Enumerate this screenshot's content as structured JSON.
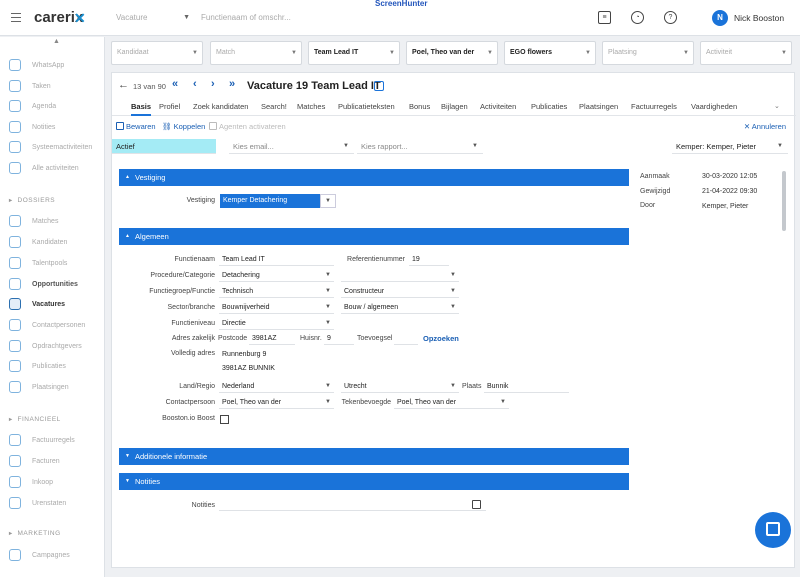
{
  "topbar": {
    "logo": "carerix",
    "selects": [
      {
        "label": "Vacature"
      },
      {
        "label": "Functienaam of omschr..."
      }
    ],
    "screenhunter": "ScreenHunter",
    "user_initial": "N",
    "user_name": "Nick Booston"
  },
  "sidebar": {
    "items": [
      {
        "label": "WhatsApp",
        "icon": "whatsapp-icon"
      },
      {
        "label": "Taken",
        "icon": "tasks-icon"
      },
      {
        "label": "Agenda",
        "icon": "calendar-icon"
      },
      {
        "label": "Notities",
        "icon": "notes-icon"
      },
      {
        "label": "Systeemactiviteiten",
        "icon": "system-activity-icon"
      },
      {
        "label": "Alle activiteiten",
        "icon": "activities-icon"
      }
    ],
    "dossiers_title": "DOSSIERS",
    "dossiers": [
      {
        "label": "Matches",
        "icon": "matches-icon"
      },
      {
        "label": "Kandidaten",
        "icon": "candidates-icon"
      },
      {
        "label": "Talentpools",
        "icon": "talentpool-icon"
      },
      {
        "label": "Opportunities",
        "icon": "opportunities-icon"
      },
      {
        "label": "Vacatures",
        "icon": "vacancies-icon"
      },
      {
        "label": "Contactpersonen",
        "icon": "contacts-icon"
      },
      {
        "label": "Opdrachtgevers",
        "icon": "clients-icon"
      },
      {
        "label": "Publicaties",
        "icon": "publications-icon"
      },
      {
        "label": "Plaatsingen",
        "icon": "placements-icon"
      }
    ],
    "financieel_title": "FINANCIEEL",
    "financieel": [
      {
        "label": "Factuurregels",
        "icon": "invoice-lines-icon"
      },
      {
        "label": "Facturen",
        "icon": "invoices-icon"
      },
      {
        "label": "Inkoop",
        "icon": "purchase-icon"
      },
      {
        "label": "Urenstaten",
        "icon": "timesheets-icon"
      }
    ],
    "marketing_title": "MARKETING",
    "marketing": [
      {
        "label": "Campagnes",
        "icon": "campaigns-icon"
      }
    ]
  },
  "filters": [
    {
      "label": "Kandidaat",
      "selected": false
    },
    {
      "label": "Match",
      "selected": false
    },
    {
      "label": "Team Lead IT",
      "selected": true
    },
    {
      "label": "Poel, Theo van der",
      "selected": true
    },
    {
      "label": "EGO flowers",
      "selected": true
    },
    {
      "label": "Plaatsing",
      "selected": false
    },
    {
      "label": "Activiteit",
      "selected": false
    }
  ],
  "record": {
    "counter": "13 van 90",
    "title": "Vacature 19 Team Lead IT",
    "tabs": [
      "Basis",
      "Profiel",
      "Zoek kandidaten",
      "Search!",
      "Matches",
      "Publicatieteksten",
      "Bonus",
      "Bijlagen",
      "Activiteiten",
      "Publicaties",
      "Plaatsingen",
      "Factuurregels",
      "Vaardigheden"
    ],
    "active_tab": "Basis",
    "actions": {
      "save": "Bewaren",
      "link": "Koppelen",
      "disabled": "Agenten activateren",
      "cancel": "Annuleren"
    },
    "status": "Actief",
    "email_placeholder": "Kies email...",
    "report_placeholder": "Kies rapport...",
    "owner": "Kemper: Kemper, Pieter"
  },
  "vestiging_section": {
    "title": "Vestiging",
    "label": "Vestiging",
    "value": "Kemper Detachering"
  },
  "algemeen": {
    "title": "Algemeen",
    "functienaam_label": "Functienaam",
    "functienaam": "Team Lead IT",
    "referentie_label": "Referentienummer",
    "referentie": "19",
    "procedure_label": "Procedure/Categorie",
    "procedure": "Detachering",
    "functiegroep_label": "Functiegroep/Functie",
    "functiegroep": "Technisch",
    "functie": "Constructeur",
    "sector_label": "Sector/branche",
    "sector": "Bouwnijverheid",
    "branche": "Bouw / algemeen",
    "niveau_label": "Functieniveau",
    "niveau": "Directie",
    "adres_label": "Adres zakelijk",
    "postcode_label": "Postcode",
    "postcode": "3981AZ",
    "huisnr_label": "Huisnr.",
    "huisnr": "9",
    "toevoeg_label": "Toevoegsel",
    "opzoeken": "Opzoeken",
    "volledig_label": "Volledig adres",
    "adres_line1": "Runnenburg 9",
    "adres_line2": "3981AZ  BUNNIK",
    "land_label": "Land/Regio",
    "land": "Nederland",
    "regio": "Utrecht",
    "plaats_label": "Plaats",
    "plaats": "Bunnik",
    "contact_label": "Contactpersoon",
    "contact": "Poel, Theo van der",
    "teken_label": "Tekenbevoegde",
    "teken": "Poel, Theo van der",
    "boost_label": "Booston.io Boost"
  },
  "additionele": {
    "title": "Additionele informatie"
  },
  "notities": {
    "title": "Notities",
    "label": "Notities"
  },
  "meta": [
    {
      "key": "Aanmaak",
      "value": "30-03-2020 12:05"
    },
    {
      "key": "Gewijzigd",
      "value": "21-04-2022 09:30"
    },
    {
      "key": "Door",
      "value": "Kemper, Pieter"
    }
  ],
  "colors": {
    "accent": "#1a73d9",
    "status_bg": "#a4ebf5"
  }
}
